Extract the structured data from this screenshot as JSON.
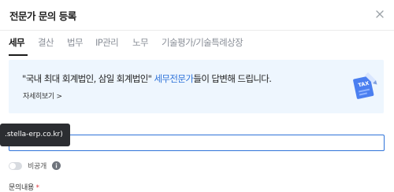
{
  "header": {
    "title": "전문가 문의 등록"
  },
  "tabs": [
    {
      "label": "세무"
    },
    {
      "label": "결산"
    },
    {
      "label": "법무"
    },
    {
      "label": "IP관리"
    },
    {
      "label": "노무"
    },
    {
      "label": "기술평가/기술특례상장"
    }
  ],
  "banner": {
    "message_prefix": "\"국내 최대 회계법인, 삼일 회계법인\" ",
    "message_accent": "세무전문가",
    "message_suffix": "들이 답변해 드립니다.",
    "link": "자세히보기 >",
    "icon_text": "TAX"
  },
  "form": {
    "tooltip_text": ".stella-erp.co.kr)",
    "input_value": "",
    "private_label": "비공개",
    "private_on": false,
    "content_label": "문의내용",
    "required_mark": "*"
  },
  "colors": {
    "accent": "#2f73d9",
    "banner_bg": "#eef6fe",
    "tooltip_bg": "#2b2d31",
    "required": "#e0383e"
  }
}
